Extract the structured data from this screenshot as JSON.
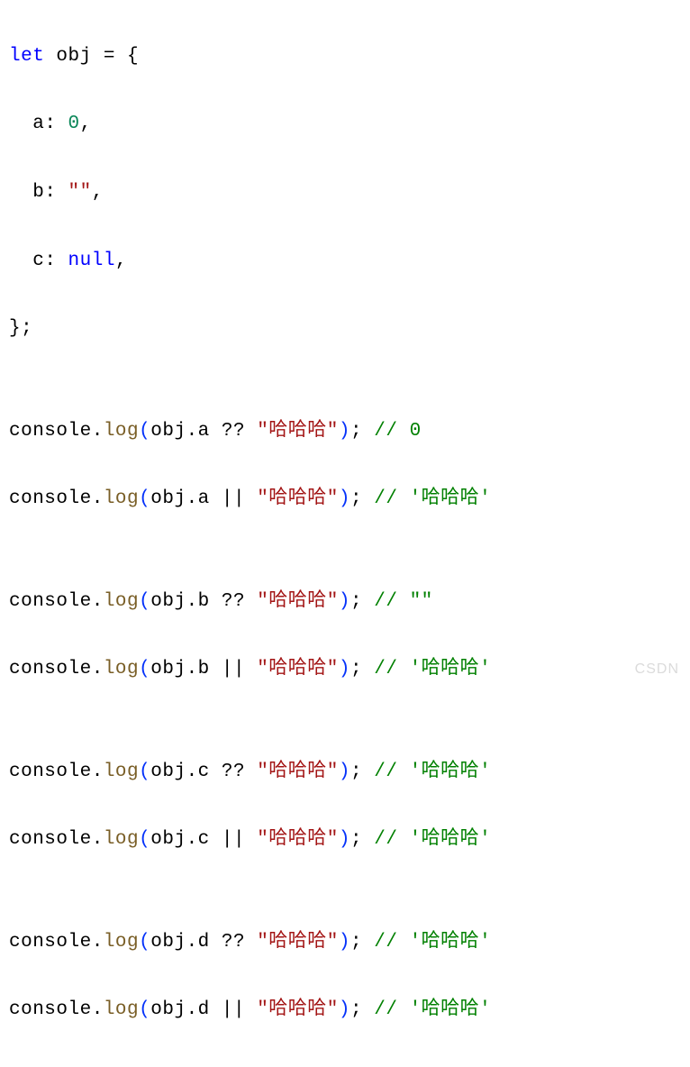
{
  "l1_let": "let",
  "l1_obj": " obj ",
  "l1_eq": "= ",
  "l1_brace": "{",
  "l2_indent": "  ",
  "l2_key": "a",
  "l2_colon": ": ",
  "l2_val": "0",
  "l2_comma": ",",
  "l3_indent": "  ",
  "l3_key": "b",
  "l3_colon": ": ",
  "l3_val": "\"\"",
  "l3_comma": ",",
  "l4_indent": "  ",
  "l4_key": "c",
  "l4_colon": ": ",
  "l4_val": "null",
  "l4_comma": ",",
  "l5_brace": "}",
  "l5_semi": ";",
  "blank": "",
  "log_console": "console",
  "log_dot": ".",
  "log_method": "log",
  "log_open": "(",
  "log_obj": "obj",
  "log_dot2": ".",
  "log_close": ")",
  "log_semi": ";",
  "op_nullish": " ?? ",
  "op_or": " || ",
  "str_haha": "\"哈哈哈\"",
  "prop_a": "a",
  "prop_b": "b",
  "prop_c": "c",
  "prop_d": "d",
  "cmt_slash": " // ",
  "cmt_0": "0",
  "cmt_haha": "'哈哈哈'",
  "cmt_empty": "\"\"",
  "watermark": "CSDN"
}
